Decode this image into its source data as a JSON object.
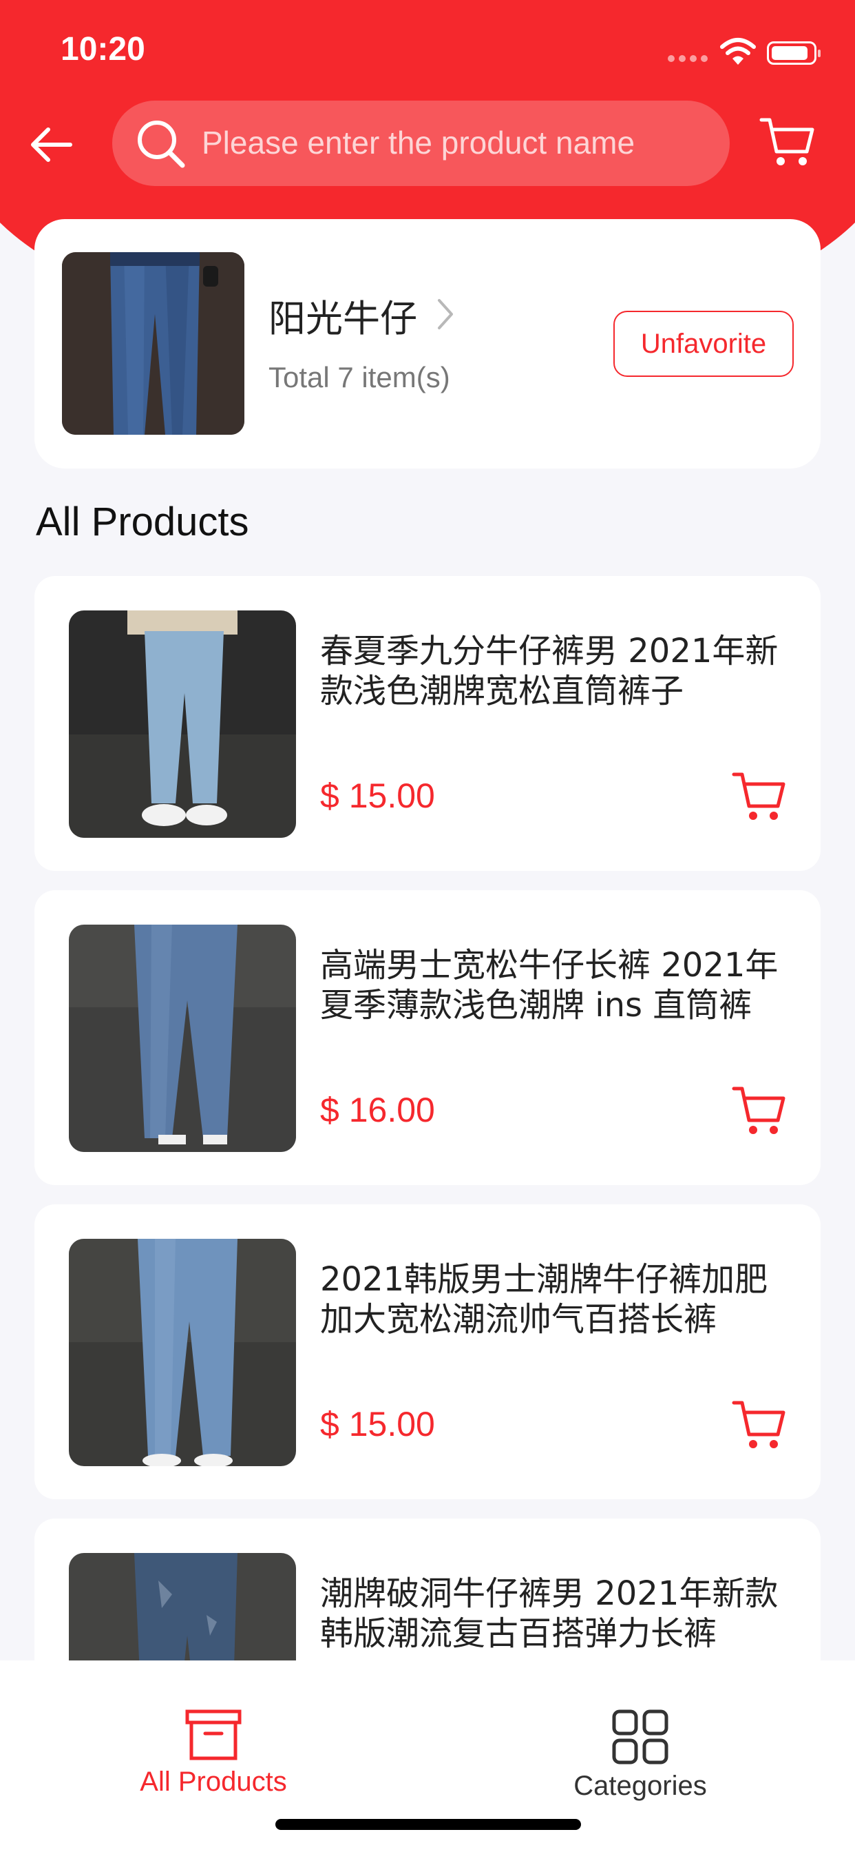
{
  "status_bar": {
    "time": "10:20"
  },
  "header": {
    "search_placeholder": "Please enter the product name",
    "icons": [
      "back-arrow-icon",
      "search-icon",
      "cart-icon"
    ]
  },
  "store": {
    "name": "阳光牛仔",
    "count_text": "Total 7 item(s)",
    "unfavorite_label": "Unfavorite"
  },
  "section_title": "All Products",
  "products": [
    {
      "title": "春夏季九分牛仔裤男 2021年新款浅色潮牌宽松直筒裤子",
      "price": "$ 15.00"
    },
    {
      "title": "高端男士宽松牛仔长裤 2021年夏季薄款浅色潮牌 ins 直筒裤",
      "price": "$ 16.00"
    },
    {
      "title": "2021韩版男士潮牌牛仔裤加肥加大宽松潮流帅气百搭长裤",
      "price": "$ 15.00"
    },
    {
      "title": "潮牌破洞牛仔裤男 2021年新款韩版潮流复古百搭弹力长裤",
      "price": ""
    }
  ],
  "bottom_nav": {
    "items": [
      {
        "label": "All Products",
        "icon": "archive-box-icon",
        "active": true
      },
      {
        "label": "Categories",
        "icon": "grid-icon",
        "active": false
      }
    ]
  },
  "colors": {
    "accent": "#f5282d",
    "background": "#f6f6fa",
    "card": "#ffffff"
  }
}
